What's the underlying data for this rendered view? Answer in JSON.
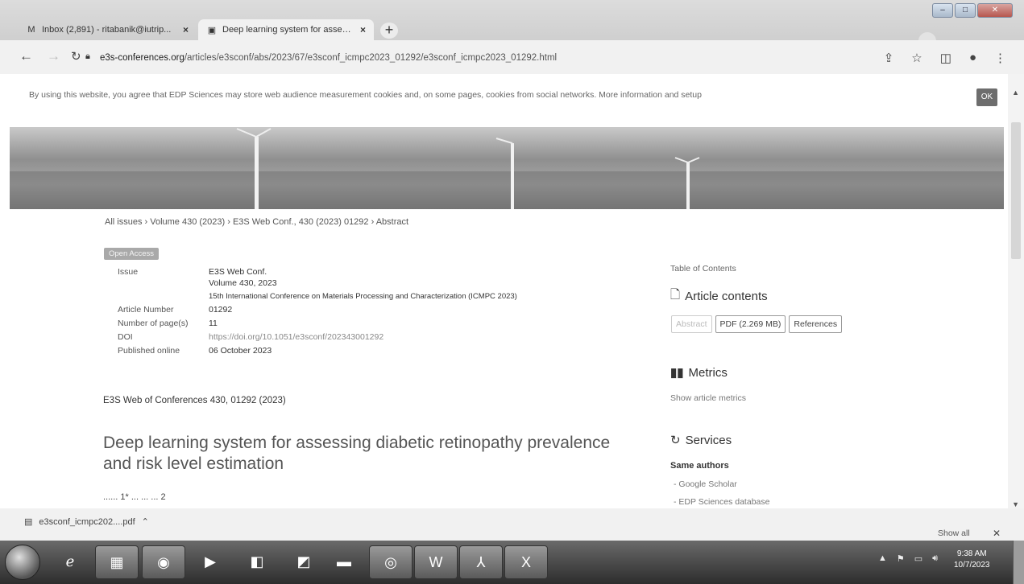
{
  "browser": {
    "tabs": [
      {
        "icon": "gmail-icon",
        "title": "Inbox (2,891) - ritabanik@iutrip...",
        "close": "×"
      },
      {
        "icon": "page-icon",
        "title": "Deep learning system for assess...",
        "close": "×"
      }
    ],
    "new_tab": "+",
    "url_domain": "e3s-conferences.org",
    "url_path": "/articles/e3sconf/abs/2023/67/e3sconf_icmpc2023_01292/e3sconf_icmpc2023_01292.html"
  },
  "cookie": {
    "text": "By using this website, you agree that EDP Sciences may store web audience measurement cookies and, on some pages, cookies from social networks. More information and setup",
    "ok": "OK"
  },
  "breadcrumb": "All issues › Volume 430 (2023) › E3S Web Conf., 430 (2023) 01292 › Abstract",
  "open_access": "Open Access",
  "meta": {
    "issue_label": "Issue",
    "issue_line1": "E3S Web Conf.",
    "issue_line2": "Volume 430, 2023",
    "issue_line3": "15th International Conference on Materials Processing and Characterization (ICMPC 2023)",
    "article_number_label": "Article Number",
    "article_number": "01292",
    "pages_label": "Number of page(s)",
    "pages": "11",
    "doi_label": "DOI",
    "doi": "https://doi.org/10.1051/e3sconf/202343001292",
    "published_label": "Published online",
    "published": "06 October 2023"
  },
  "citation": "E3S Web of Conferences 430, 01292 (2023)",
  "title": "Deep learning system for assessing diabetic retinopathy prevalence and risk level estimation",
  "authors_partial": "...... 1* ... ... ... 2",
  "sidebar": {
    "toc_label": "Table of Contents",
    "article_contents": "Article contents",
    "btn_abstract": "Abstract",
    "btn_pdf": "PDF (2.269 MB)",
    "btn_references": "References",
    "metrics": "Metrics",
    "show_metrics": "Show article metrics",
    "services": "Services",
    "same_authors": "Same authors",
    "google_scholar": "- Google Scholar",
    "edp_database": "- EDP Sciences database"
  },
  "downloads": {
    "file": "e3sconf_icmpc202....pdf",
    "show_all": "Show all",
    "close": "✕"
  },
  "taskbar": {
    "time": "9:38 AM",
    "date": "10/7/2023"
  }
}
